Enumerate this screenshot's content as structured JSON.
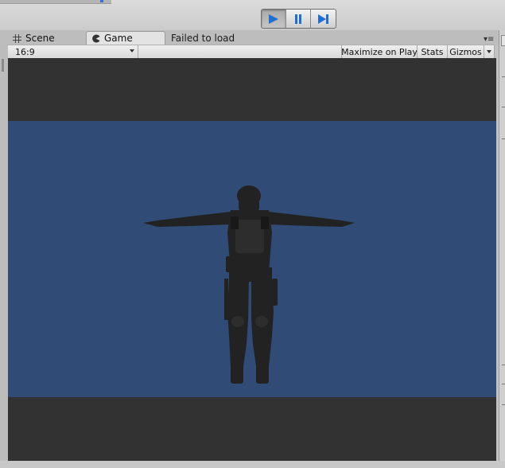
{
  "toolbar": {
    "play_label": "Play",
    "pause_label": "Pause",
    "step_label": "Step"
  },
  "tabs": {
    "scene_label": "Scene",
    "game_label": "Game",
    "status_text": "Failed to load"
  },
  "game_toolbar": {
    "aspect_value": "16:9",
    "maximize_label": "Maximize on Play",
    "stats_label": "Stats",
    "gizmos_label": "Gizmos"
  },
  "colors": {
    "sky": "#304b75",
    "letterbox": "#323232",
    "active_accent": "#1f6fd1"
  },
  "icons": {
    "scene_tab": "grid-icon",
    "game_tab": "pacman-icon",
    "play": "play-icon",
    "pause": "pause-icon",
    "step": "step-forward-icon"
  }
}
